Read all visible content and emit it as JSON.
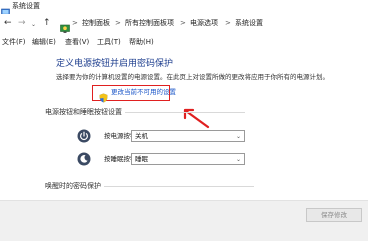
{
  "window": {
    "title": "系统设置"
  },
  "nav": {
    "back": "←",
    "forward": "→",
    "dropdown": "⌄",
    "up": "↑",
    "separator": ">",
    "breadcrumb": [
      "控制面板",
      "所有控制面板项",
      "电源选项",
      "系统设置"
    ]
  },
  "menu": [
    "文件(F)",
    "编辑(E)",
    "查看(V)",
    "工具(T)",
    "帮助(H)"
  ],
  "main": {
    "heading": "定义电源按钮并启用密码保护",
    "description": "选择要为你的计算机设置的电源设置。在此页上对设置所做的更改将应用于你所有的电源计划。",
    "change_link": "更改当前不可用的设置",
    "section_buttons": "电源按钮和睡眠按钮设置",
    "power_button_label": "按电源按钮时:",
    "power_button_value": "关机",
    "sleep_button_label": "按睡眠按钮时:",
    "sleep_button_value": "睡眠",
    "section_password": "唤醒时的密码保护"
  },
  "footer": {
    "save": "保存修改"
  },
  "colors": {
    "heading": "#1f3f8f",
    "link": "#1a56c8",
    "highlight": "#e02020"
  }
}
